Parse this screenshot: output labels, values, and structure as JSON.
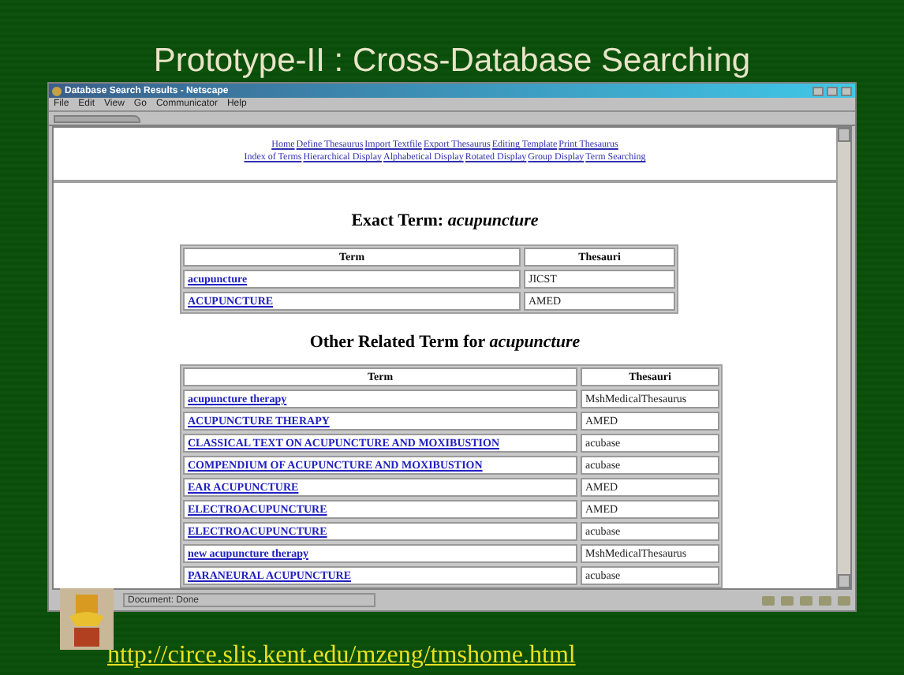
{
  "slide": {
    "title": "Prototype-II : Cross-Database Searching",
    "url": "http://circe.slis.kent.edu/mzeng/tmshome.html"
  },
  "window": {
    "title": "Database Search Results - Netscape",
    "menu": [
      "File",
      "Edit",
      "View",
      "Go",
      "Communicator",
      "Help"
    ]
  },
  "nav_links": [
    [
      "Home",
      "Define Thesaurus",
      "Import Textfile",
      "Export Thesaurus",
      "Editing Template",
      "Print Thesaurus"
    ],
    [
      "Index of Terms",
      "Hierarchical Display",
      "Alphabetical Display",
      "Rotated Display",
      "Group Display",
      "Term Searching"
    ]
  ],
  "exact": {
    "heading": "Exact Term: ",
    "term": "acupuncture",
    "columns": [
      "Term",
      "Thesauri"
    ],
    "rows": [
      {
        "term": "acupuncture",
        "thesauri": "JICST"
      },
      {
        "term": "ACUPUNCTURE",
        "thesauri": "AMED"
      }
    ]
  },
  "related": {
    "heading": "Other Related Term for ",
    "term": "acupuncture",
    "columns": [
      "Term",
      "Thesauri"
    ],
    "rows": [
      {
        "term": "acupuncture therapy",
        "thesauri": "MshMedicalThesaurus"
      },
      {
        "term": "ACUPUNCTURE THERAPY",
        "thesauri": "AMED"
      },
      {
        "term": "CLASSICAL TEXT ON ACUPUNCTURE AND MOXIBUSTION",
        "thesauri": "acubase"
      },
      {
        "term": "COMPENDIUM OF ACUPUNCTURE AND MOXIBUSTION",
        "thesauri": "acubase"
      },
      {
        "term": "EAR ACUPUNCTURE",
        "thesauri": "AMED"
      },
      {
        "term": "ELECTROACUPUNCTURE",
        "thesauri": "AMED"
      },
      {
        "term": "ELECTROACUPUNCTURE",
        "thesauri": "acubase"
      },
      {
        "term": "new acupuncture therapy",
        "thesauri": "MshMedicalThesaurus"
      },
      {
        "term": "PARANEURAL ACUPUNCTURE",
        "thesauri": "acubase"
      }
    ]
  },
  "status_bar": {
    "text": "Document: Done"
  }
}
